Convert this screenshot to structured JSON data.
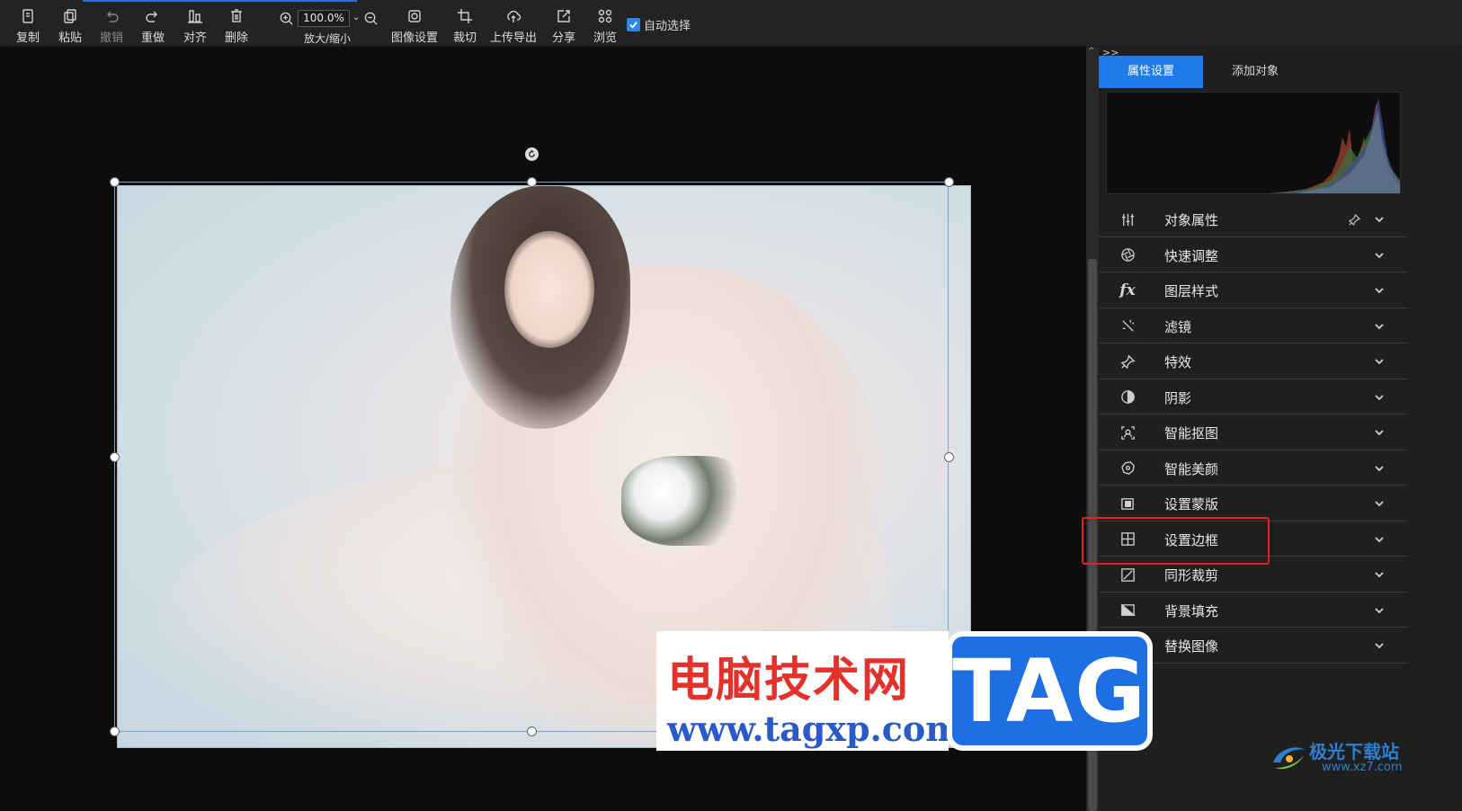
{
  "toolbar": {
    "copy": "复制",
    "paste": "粘贴",
    "undo": "撤销",
    "redo": "重做",
    "align": "对齐",
    "delete": "删除",
    "zoom_value": "100.0%",
    "zoom_label": "放大/缩小",
    "image_settings": "图像设置",
    "crop": "裁切",
    "upload_export": "上传导出",
    "share": "分享",
    "browse": "浏览",
    "auto_select": "自动选择",
    "auto_select_checked": true
  },
  "panel": {
    "collapse": ">>",
    "tabs": [
      {
        "label": "属性设置",
        "active": true
      },
      {
        "label": "添加对象",
        "active": false
      }
    ],
    "items": [
      {
        "label": "对象属性",
        "icon": "sliders-icon"
      },
      {
        "label": "快速调整",
        "icon": "aperture-icon"
      },
      {
        "label": "图层样式",
        "icon": "fx-icon",
        "icon_text": "fx"
      },
      {
        "label": "滤镜",
        "icon": "magic-wand-icon"
      },
      {
        "label": "特效",
        "icon": "sparkle-pin-icon"
      },
      {
        "label": "阴影",
        "icon": "shadow-circle-icon"
      },
      {
        "label": "智能抠图",
        "icon": "smart-cutout-icon"
      },
      {
        "label": "智能美颜",
        "icon": "beauty-icon"
      },
      {
        "label": "设置蒙版",
        "icon": "mask-icon"
      },
      {
        "label": "设置边框",
        "icon": "border-icon"
      },
      {
        "label": "同形裁剪",
        "icon": "shape-crop-icon"
      },
      {
        "label": "背景填充",
        "icon": "background-fill-icon"
      },
      {
        "label": "替换图像",
        "icon": "replace-image-icon"
      }
    ]
  },
  "watermark": {
    "cn": "电脑技术网",
    "url": "www.tagxp.com",
    "tag": "TAG"
  },
  "logo": {
    "name": "极光下载站",
    "site": "www.xz7.com"
  },
  "colors": {
    "accent": "#1e7ce8",
    "highlight": "#e0241b"
  }
}
